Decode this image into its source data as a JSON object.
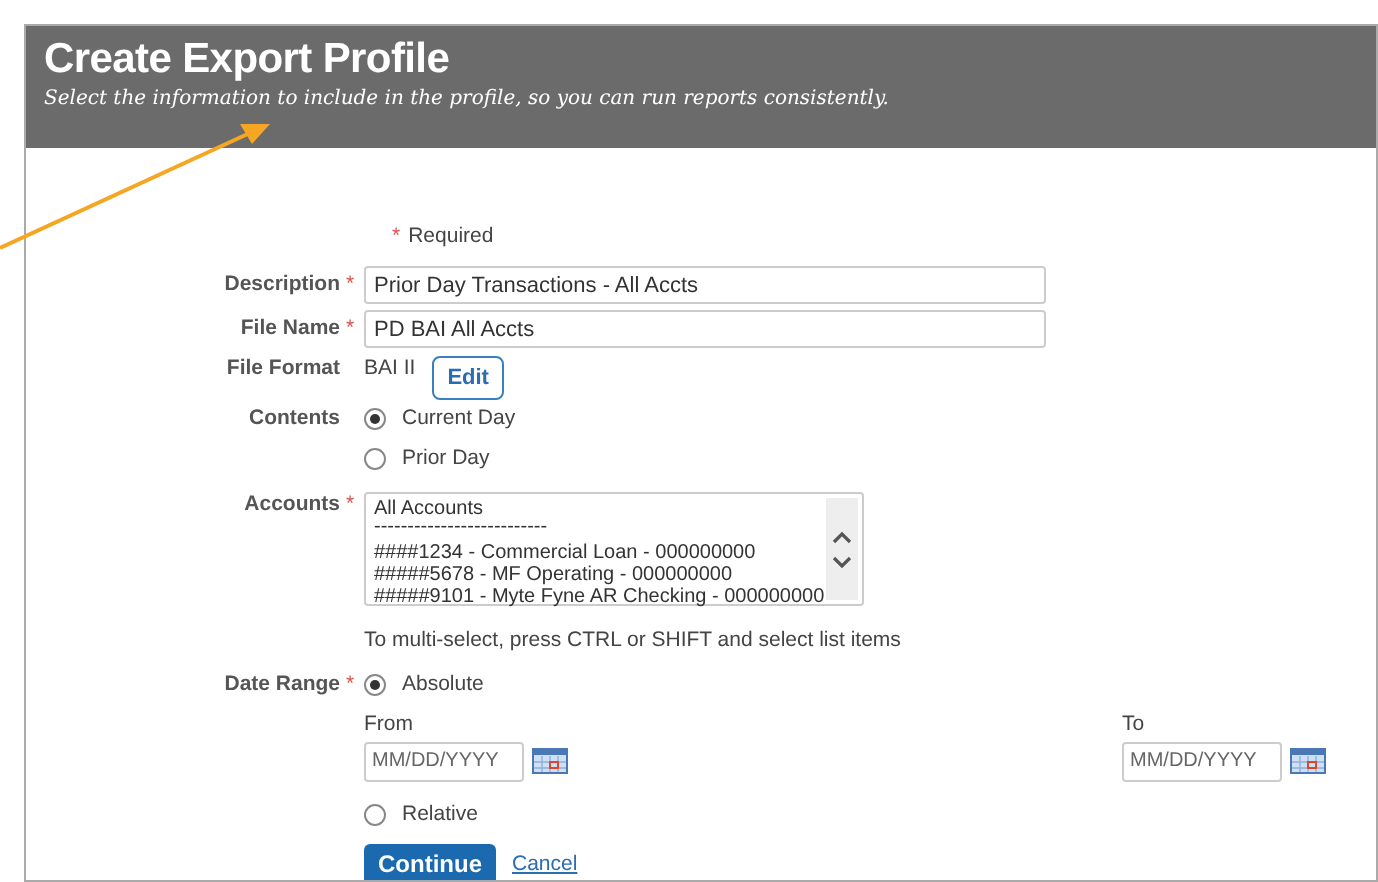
{
  "header": {
    "title": "Create Export Profile",
    "subtitle": "Select the information to include in the profile, so you can run reports consistently."
  },
  "required_note": {
    "mark": "*",
    "text": "Required"
  },
  "fields": [
    {
      "kind": "text",
      "label": "Description",
      "required_mark": "*",
      "value": "Prior Day Transactions - All Accts"
    },
    {
      "kind": "text",
      "label": "File Name",
      "required_mark": "*",
      "value": "PD BAI All Accts"
    },
    {
      "kind": "static",
      "label": "File Format",
      "value": "BAI II",
      "button": "Edit"
    },
    {
      "kind": "radio",
      "label": "Contents",
      "options": [
        {
          "label": "Current Day",
          "selected": true
        },
        {
          "label": "Prior Day",
          "selected": false
        }
      ]
    },
    {
      "kind": "listbox",
      "label": "Accounts",
      "required_mark": "*",
      "items": [
        "All Accounts",
        "--------------------------",
        "####1234 - Commercial Loan - 000000000",
        "#####5678 - MF Operating - 000000000",
        "#####9101 - Myte Fyne AR Checking - 000000000"
      ],
      "hint": "To multi-select, press CTRL or SHIFT and select list items"
    },
    {
      "kind": "daterange",
      "label": "Date Range",
      "required_mark": "*",
      "options": [
        {
          "label": "Absolute",
          "selected": true
        },
        {
          "label": "Relative",
          "selected": false
        }
      ],
      "from": {
        "label": "From",
        "placeholder": "MM/DD/YYYY"
      },
      "to": {
        "label": "To",
        "placeholder": "MM/DD/YYYY"
      }
    }
  ],
  "actions": {
    "primary": "Continue",
    "secondary": "Cancel"
  }
}
